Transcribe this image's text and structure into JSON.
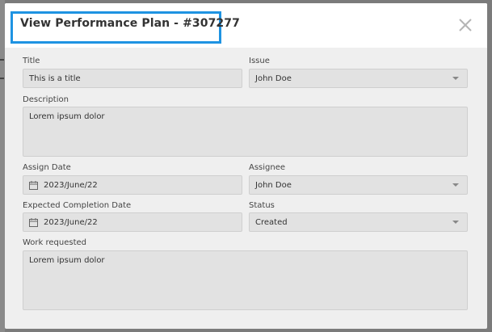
{
  "modal": {
    "title": "View Performance Plan - #307277"
  },
  "form": {
    "title": {
      "label": "Title",
      "value": "This is a title"
    },
    "issue": {
      "label": "Issue",
      "value": "John Doe"
    },
    "description": {
      "label": "Description",
      "value": "Lorem ipsum dolor"
    },
    "assign_date": {
      "label": "Assign Date",
      "value": "2023/June/22"
    },
    "assignee": {
      "label": "Assignee",
      "value": "John Doe"
    },
    "expected_completion_date": {
      "label": "Expected Completion Date",
      "value": "2023/June/22"
    },
    "status": {
      "label": "Status",
      "value": "Created"
    },
    "work_requested": {
      "label": "Work requested",
      "value": "Lorem ipsum dolor"
    }
  },
  "icons": {
    "close": "close-icon",
    "calendar": "calendar-icon",
    "dropdown": "chevron-down-icon"
  },
  "colors": {
    "highlight_border": "#1e93e2",
    "overlay": "#7b7b7b",
    "field_background": "#e2e2e2"
  }
}
